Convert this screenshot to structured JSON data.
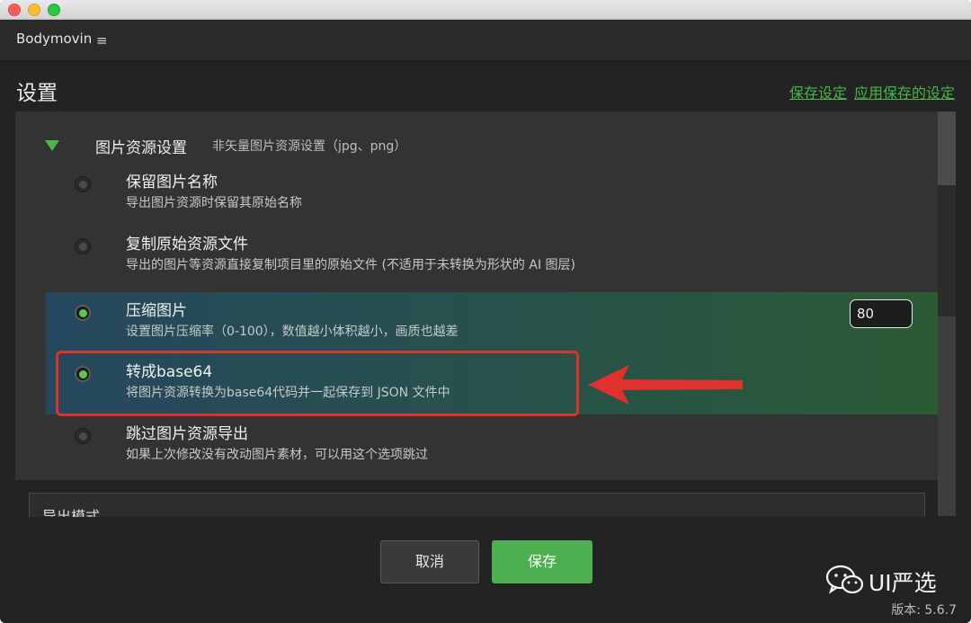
{
  "window": {
    "traffic_lights": [
      "close",
      "minimize",
      "zoom"
    ]
  },
  "appbar": {
    "title": "Bodymovin",
    "menu_icon": "≡"
  },
  "header": {
    "title": "设置",
    "save_settings_link": "保存设定",
    "apply_saved_link": "应用保存的设定"
  },
  "section": {
    "title": "图片资源设置",
    "subtitle": "非矢量图片资源设置（jpg、png）",
    "options": [
      {
        "title": "保留图片名称",
        "desc": "导出图片资源时保留其原始名称",
        "selected": false
      },
      {
        "title": "复制原始资源文件",
        "desc": "导出的图片等资源直接复制项目里的原始文件 (不适用于未转换为形状的 AI 图层)",
        "selected": false
      },
      {
        "title": "压缩图片",
        "desc": "设置图片压缩率（0-100），数值越小体积越小，画质也越差",
        "selected": true,
        "value": "80"
      },
      {
        "title": "转成base64",
        "desc": "将图片资源转换为base64代码并一起保存到 JSON 文件中",
        "selected": true
      },
      {
        "title": "跳过图片资源导出",
        "desc": "如果上次修改没有改动图片素材，可以用这个选项跳过",
        "selected": false
      }
    ]
  },
  "export_section": {
    "title": "导出模式"
  },
  "footer": {
    "cancel_label": "取消",
    "save_label": "保存"
  },
  "watermark": {
    "text": "UI严选"
  },
  "version": "版本: 5.6.7",
  "colors": {
    "accent": "#4caf50",
    "highlight_box": "#e0312d",
    "background": "#232323"
  }
}
